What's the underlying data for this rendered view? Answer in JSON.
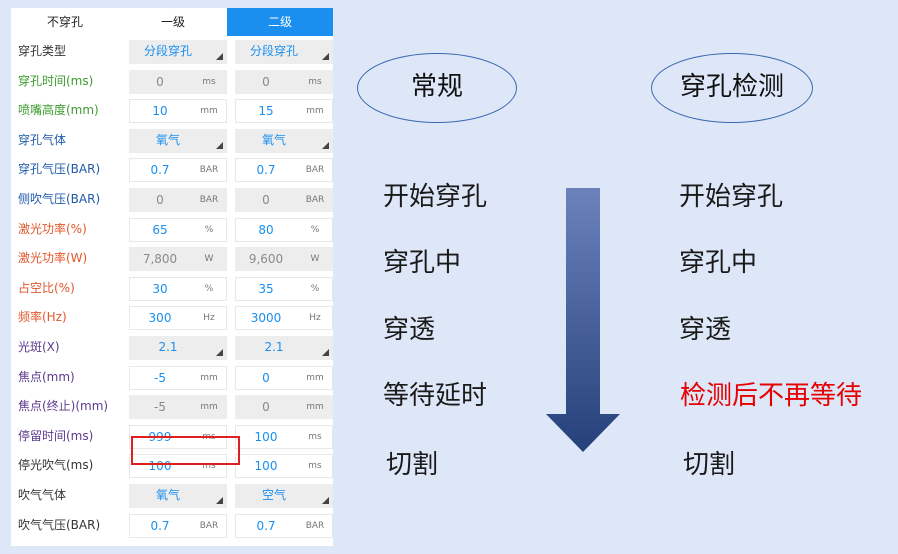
{
  "tabs": [
    "不穿孔",
    "一级",
    "二级"
  ],
  "rows": [
    {
      "label": "穿孔类型",
      "color": "dark",
      "type": "select",
      "lv1": "分段穿孔",
      "lv2": "分段穿孔"
    },
    {
      "label": "穿孔时间(ms)",
      "color": "green",
      "type": "field",
      "lv1": "0",
      "lv2": "0",
      "unit": "ms",
      "disabled": true
    },
    {
      "label": "喷嘴高度(mm)",
      "color": "green",
      "type": "field",
      "lv1": "10",
      "lv2": "15",
      "unit": "mm"
    },
    {
      "label": "穿孔气体",
      "color": "blue",
      "type": "select",
      "lv1": "氧气",
      "lv2": "氧气"
    },
    {
      "label": "穿孔气压(BAR)",
      "color": "blue",
      "type": "field",
      "lv1": "0.7",
      "lv2": "0.7",
      "unit": "BAR"
    },
    {
      "label": "侧吹气压(BAR)",
      "color": "blue",
      "type": "field",
      "lv1": "0",
      "lv2": "0",
      "unit": "BAR",
      "disabled": true
    },
    {
      "label": "激光功率(%)",
      "color": "orange",
      "type": "field",
      "lv1": "65",
      "lv2": "80",
      "unit": "%"
    },
    {
      "label": "激光功率(W)",
      "color": "orange",
      "type": "field",
      "lv1": "7,800",
      "lv2": "9,600",
      "unit": "W",
      "disabled": true
    },
    {
      "label": "占空比(%)",
      "color": "orange",
      "type": "field",
      "lv1": "30",
      "lv2": "35",
      "unit": "%"
    },
    {
      "label": "频率(Hz)",
      "color": "orange",
      "type": "field",
      "lv1": "300",
      "lv2": "3000",
      "unit": "Hz"
    },
    {
      "label": "光斑(X)",
      "color": "purple",
      "type": "select",
      "lv1": "2.1",
      "lv2": "2.1"
    },
    {
      "label": "焦点(mm)",
      "color": "purple",
      "type": "field",
      "lv1": "-5",
      "lv2": "0",
      "unit": "mm"
    },
    {
      "label": "焦点(终止)(mm)",
      "color": "purple",
      "type": "field",
      "lv1": "-5",
      "lv2": "0",
      "unit": "mm",
      "disabled": true
    },
    {
      "label": "停留时间(ms)",
      "color": "purple",
      "type": "field",
      "lv1": "999",
      "lv2": "100",
      "unit": "ms"
    },
    {
      "label": "停光吹气(ms)",
      "color": "dark",
      "type": "field",
      "lv1": "100",
      "lv2": "100",
      "unit": "ms"
    },
    {
      "label": "吹气气体",
      "color": "dark",
      "type": "select",
      "lv1": "氧气",
      "lv2": "空气"
    },
    {
      "label": "吹气气压(BAR)",
      "color": "dark",
      "type": "field",
      "lv1": "0.7",
      "lv2": "0.7",
      "unit": "BAR"
    }
  ],
  "diagram": {
    "left_title": "常规",
    "right_title": "穿孔检测",
    "left_steps": [
      "开始穿孔",
      "穿孔中",
      "穿透",
      "等待延时",
      "切割"
    ],
    "right_steps": [
      "开始穿孔",
      "穿孔中",
      "穿透",
      "检测后不再等待",
      "切割"
    ],
    "highlight_color": "#e60000"
  },
  "colors": {
    "tab_active": "#1a8ff0",
    "value_text": "#1a8ff0",
    "highlight_box": "#e02020",
    "arrow_top": "#6b82bd",
    "arrow_bottom": "#25407a"
  }
}
